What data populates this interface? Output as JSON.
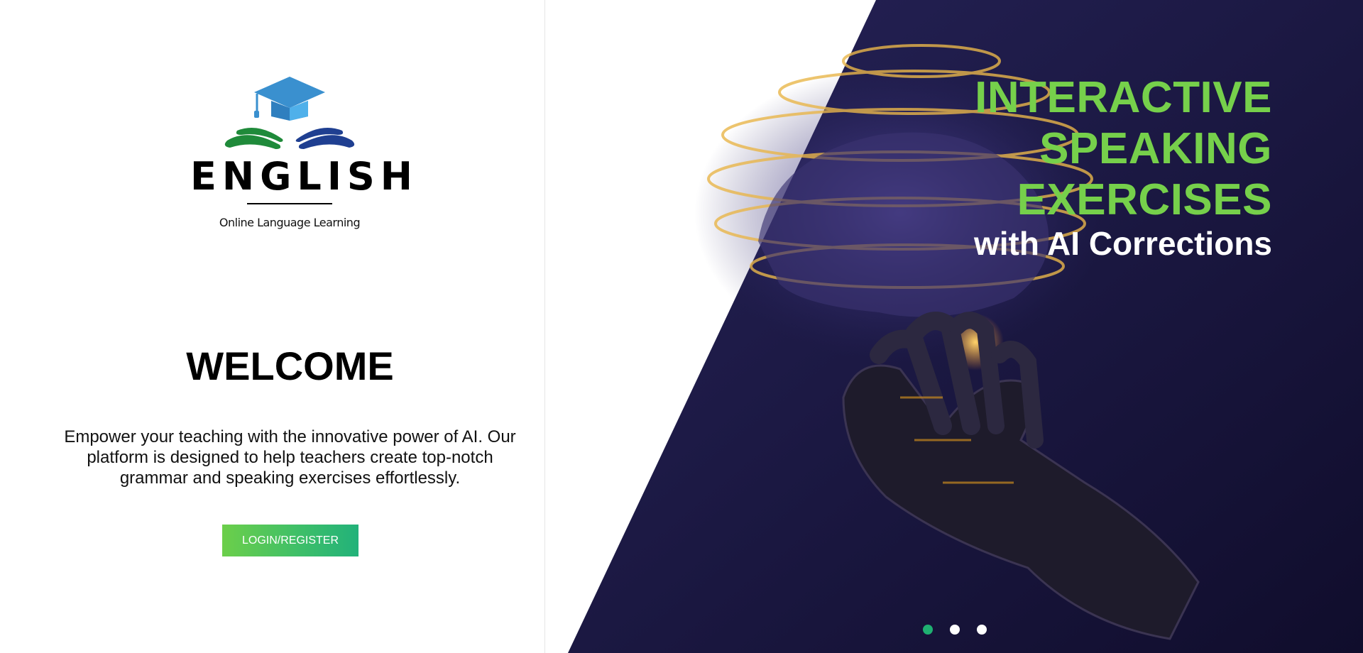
{
  "logo": {
    "wordmark": "ENGLISH",
    "tagline": "Online Language Learning",
    "colors": {
      "cap": "#3a90cf",
      "cap_side": "#4fb0ea",
      "book_left": "#1f8a3a",
      "book_right": "#1f3f91"
    }
  },
  "welcome": {
    "title": "WELCOME",
    "text": "Empower your teaching with the innovative power of AI. Our platform is designed to help teachers create top-notch grammar and speaking exercises effortlessly.",
    "button_label": "LOGIN/REGISTER"
  },
  "hero": {
    "headline_lines": [
      "INTERACTIVE",
      "SPEAKING",
      "EXERCISES"
    ],
    "subline": "with AI Corrections",
    "headline_color": "#76d04b",
    "background_color": "#15123a",
    "slides": {
      "count": 3,
      "active": 1
    },
    "dot_active_color": "#1fb071"
  }
}
